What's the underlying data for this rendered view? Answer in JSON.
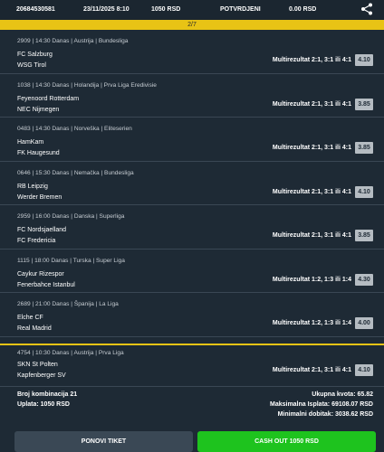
{
  "header": {
    "ticket_id": "20684530581",
    "datetime": "23/11/2025 8:10",
    "stake": "1050 RSD",
    "status": "POTVRDJENI",
    "win": "0.00 RSD",
    "share_icon": "share-icon"
  },
  "pager": {
    "text": "2/7"
  },
  "matches": [
    {
      "meta": "2909 | 14:30 Danas | Austrija | Bundesliga",
      "home": "FC Salzburg",
      "away": "WSG Tirol",
      "tip": "Multirezultat 2:1, 3:1 ili 4:1",
      "odd": "4.10"
    },
    {
      "meta": "1038 | 14:30 Danas | Holandija | Prva Liga Eredivisie",
      "home": "Feyenoord Rotterdam",
      "away": "NEC Nijmegen",
      "tip": "Multirezultat 2:1, 3:1 ili 4:1",
      "odd": "3.85"
    },
    {
      "meta": "0483 | 14:30 Danas | Norveška | Eliteserien",
      "home": "HamKam",
      "away": "FK Haugesund",
      "tip": "Multirezultat 2:1, 3:1 ili 4:1",
      "odd": "3.85"
    },
    {
      "meta": "0646 | 15:30 Danas | Nemačka | Bundesliga",
      "home": "RB Leipzig",
      "away": "Werder Bremen",
      "tip": "Multirezultat 2:1, 3:1 ili 4:1",
      "odd": "4.10"
    },
    {
      "meta": "2959 | 16:00 Danas | Danska | Superliga",
      "home": "FC Nordsjaelland",
      "away": "FC Fredericia",
      "tip": "Multirezultat 2:1, 3:1 ili 4:1",
      "odd": "3.85"
    },
    {
      "meta": "1115 | 18:00 Danas | Turska | Super Liga",
      "home": "Caykur Rizespor",
      "away": "Fenerbahce Istanbul",
      "tip": "Multirezultat 1:2, 1:3 ili 1:4",
      "odd": "4.30"
    },
    {
      "meta": "2689 | 21:00 Danas | Španija | La Liga",
      "home": "Elche CF",
      "away": "Real Madrid",
      "tip": "Multirezultat 1:2, 1:3 ili 1:4",
      "odd": "4.00"
    }
  ],
  "last_match": {
    "meta": "4754 | 10:30 Danas | Austrija | Prva Liga",
    "home": "SKN St Polten",
    "away": "Kapfenberger SV",
    "tip": "Multirezultat 2:1, 3:1 ili 4:1",
    "odd": "4.10"
  },
  "summary": {
    "combinations": "Broj kombinacija 21",
    "payment": "Uplata: 1050 RSD",
    "total_odds": "Ukupna kvota: 65.82",
    "max_payout": "Maksimalna Isplata: 69108.07 RSD",
    "min_win": "Minimalni dobitak: 3038.62 RSD"
  },
  "buttons": {
    "repeat": "PONOVI TIKET",
    "cashout": "CASH OUT 1050 RSD"
  },
  "colors": {
    "background": "#1e2a35",
    "accent": "#e8c315",
    "cashout": "#1ec31e",
    "odd_box": "#b5bcc2"
  }
}
